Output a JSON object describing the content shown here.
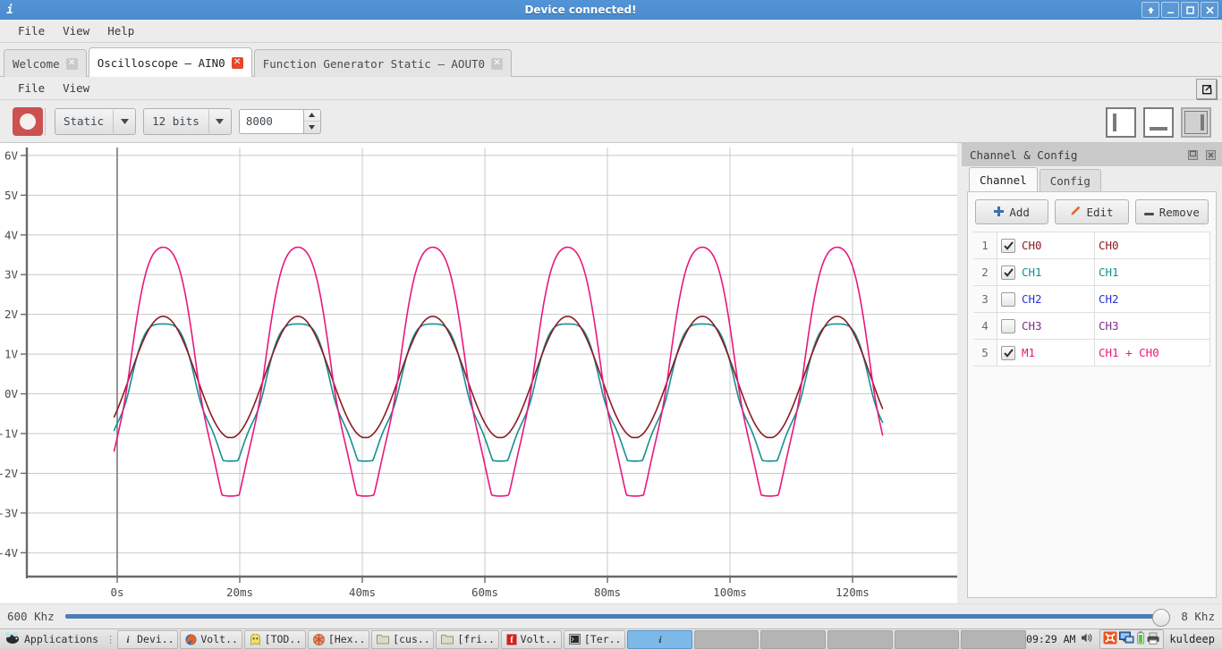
{
  "window": {
    "title": "Device connected!",
    "icon": "info-icon",
    "buttons": [
      {
        "name": "shade-button",
        "glyph": "arrow-up-icon"
      },
      {
        "name": "minimize-button",
        "glyph": "minimize-icon"
      },
      {
        "name": "maximize-button",
        "glyph": "maximize-icon"
      },
      {
        "name": "close-button",
        "glyph": "close-icon"
      }
    ]
  },
  "menubar": [
    "File",
    "View",
    "Help"
  ],
  "tabs": [
    {
      "label": "Welcome",
      "active": false
    },
    {
      "label": "Oscilloscope — AIN0",
      "active": true
    },
    {
      "label": "Function Generator Static — AOUT0",
      "active": false
    }
  ],
  "inner_menubar": [
    "File",
    "View"
  ],
  "toolbar": {
    "record_button": "record-button",
    "mode_select": "Static",
    "bits_select": "12 bits",
    "samples_value": "8000",
    "layout_buttons": [
      "layout-left",
      "layout-bottom",
      "layout-right"
    ],
    "layout_selected": 2,
    "popout_button": "popout-icon"
  },
  "plot": {
    "y_ticks": [
      "6V",
      "5V",
      "4V",
      "3V",
      "2V",
      "1V",
      "0V",
      "-1V",
      "-2V",
      "-3V",
      "-4V"
    ],
    "x_ticks": [
      "0s",
      "20ms",
      "40ms",
      "60ms",
      "80ms",
      "100ms",
      "120ms"
    ]
  },
  "slider": {
    "min_label": "600 Khz",
    "max_label": "8 Khz",
    "value_pct": 100
  },
  "dock": {
    "title": "Channel & Config",
    "float_icon": "float-icon",
    "close_icon": "close-icon",
    "tabs": [
      {
        "label": "Channel",
        "active": true
      },
      {
        "label": "Config",
        "active": false
      }
    ],
    "buttons": [
      {
        "label": "Add",
        "icon": "plus-icon"
      },
      {
        "label": "Edit",
        "icon": "pencil-icon"
      },
      {
        "label": "Remove",
        "icon": "minus-icon"
      }
    ],
    "channels": [
      {
        "num": "1",
        "name": "CH0",
        "expr": "CH0",
        "checked": true,
        "color": "#8b1a22"
      },
      {
        "num": "2",
        "name": "CH1",
        "expr": "CH1",
        "checked": true,
        "color": "#168f92"
      },
      {
        "num": "3",
        "name": "CH2",
        "expr": "CH2",
        "checked": false,
        "color": "#2b32d8"
      },
      {
        "num": "4",
        "name": "CH3",
        "expr": "CH3",
        "checked": false,
        "color": "#7b2d8e"
      },
      {
        "num": "5",
        "name": "M1",
        "expr": "CH1 + CH0",
        "checked": true,
        "color": "#e8187e"
      }
    ]
  },
  "taskbar": {
    "applications": "Applications",
    "items": [
      {
        "label": "Devi..",
        "icon": "info-icon",
        "active": false
      },
      {
        "label": "Volt..",
        "icon": "firefox-icon",
        "active": false
      },
      {
        "label": "[TOD..",
        "icon": "ghost-icon",
        "active": false
      },
      {
        "label": "[Hex..",
        "icon": "hex-icon",
        "active": false
      },
      {
        "label": "[cus..",
        "icon": "folder-icon",
        "active": false
      },
      {
        "label": "[fri..",
        "icon": "folder-icon",
        "active": false
      },
      {
        "label": "Volt..",
        "icon": "pdf-icon",
        "active": false
      },
      {
        "label": "[Ter..",
        "icon": "terminal-icon",
        "active": false
      },
      {
        "label": "",
        "icon": "info-icon",
        "active": true
      }
    ],
    "empty_slots": 5,
    "clock": "09:29 AM",
    "user": "kuldeep",
    "tray": [
      "volume-icon",
      "network-icon",
      "display-icon",
      "battery-icon",
      "printer-icon"
    ]
  },
  "chart_data": {
    "type": "line",
    "title": "",
    "xlabel": "",
    "ylabel": "",
    "xlim": [
      -19,
      126
    ],
    "ylim": [
      -4.6,
      6.2
    ],
    "x_unit": "ms",
    "y_unit": "V",
    "grid": true,
    "x_ticks": [
      0,
      20,
      40,
      60,
      80,
      100,
      120
    ],
    "y_ticks": [
      -4,
      -3,
      -2,
      -1,
      0,
      1,
      2,
      3,
      4,
      5,
      6
    ],
    "legend": "none",
    "period_ms": 22.0,
    "trigger_x_ms": 0,
    "data_start_ms": -0.5,
    "data_end_ms": 125,
    "series": [
      {
        "name": "CH0",
        "color": "#8b1a22",
        "shape": "clipped-sine",
        "amplitude": 1.53,
        "offset": 0.42,
        "clip_high": 1.95,
        "clip_low": -1.1,
        "phase_ms": 2.0,
        "ripple": 0.0
      },
      {
        "name": "CH1",
        "color": "#168f92",
        "shape": "clipped-sine-with-notch",
        "amplitude": 1.8,
        "offset": 0.15,
        "clip_high": 1.95,
        "clip_low": -1.68,
        "phase_ms": 2.0,
        "ripple": 0.55
      },
      {
        "name": "M1",
        "color": "#e8187e",
        "shape": "clipped-sine-with-notch",
        "amplitude": 3.3,
        "offset": 0.6,
        "clip_high": 3.85,
        "clip_low": -2.55,
        "phase_ms": 2.0,
        "ripple": 0.6
      }
    ]
  }
}
